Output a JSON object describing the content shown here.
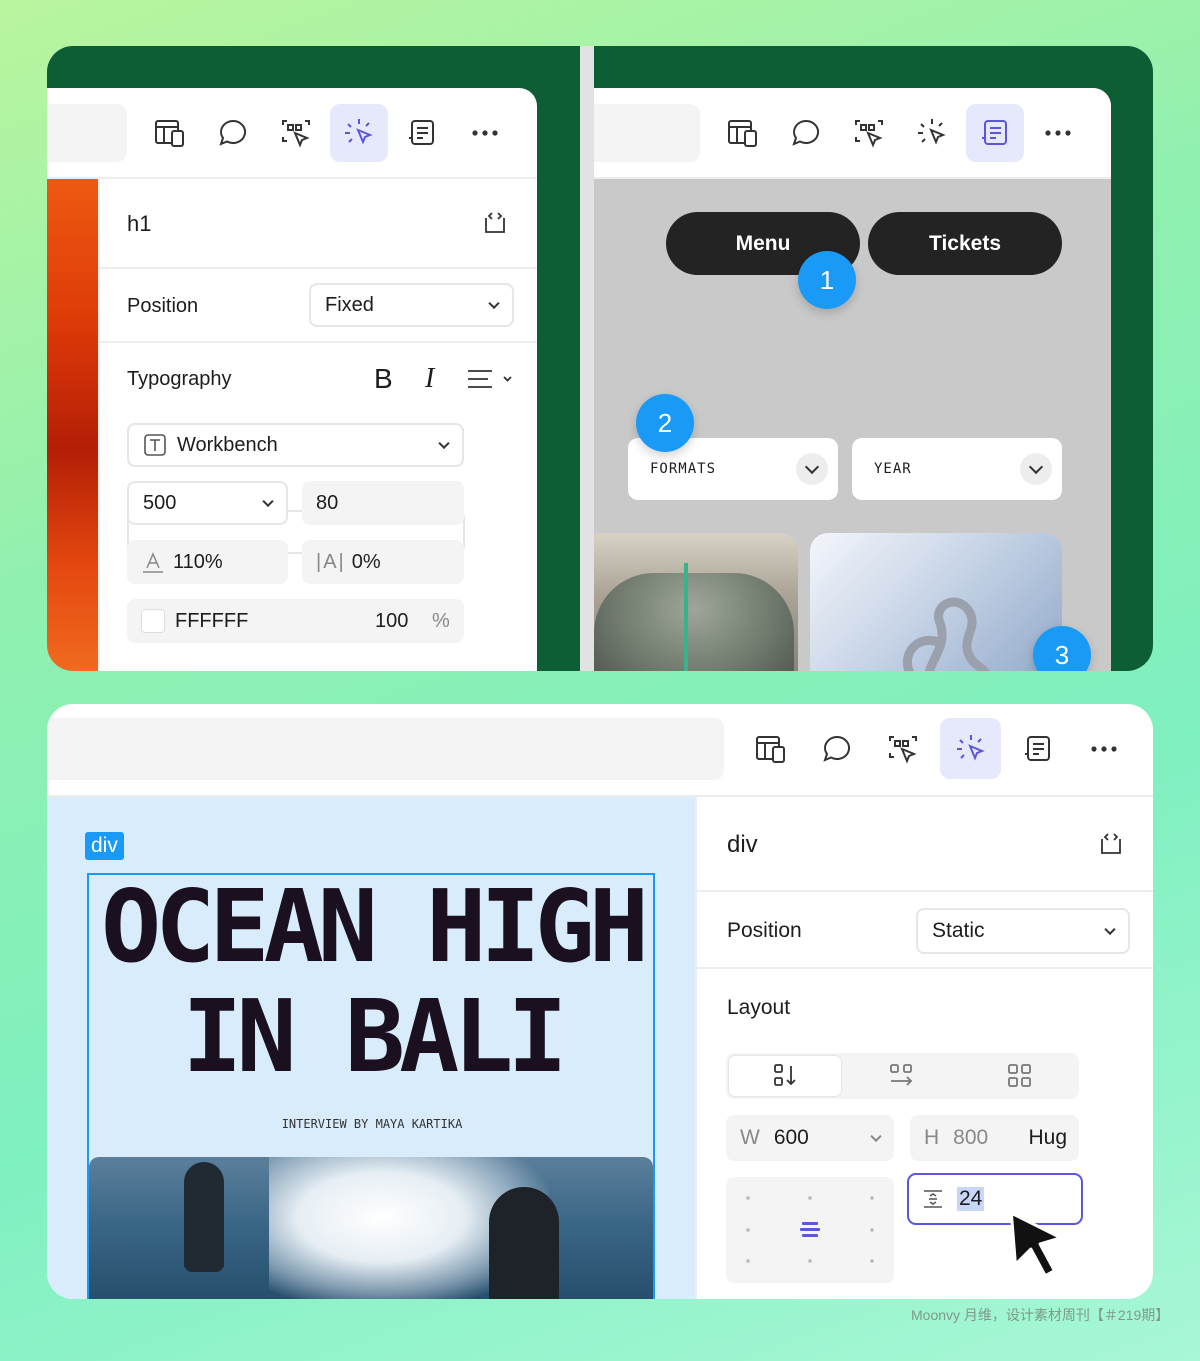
{
  "panel1": {
    "element_tag": "h1",
    "position_label": "Position",
    "position_value": "Fixed",
    "typography_label": "Typography",
    "bold_glyph": "B",
    "italic_glyph": "I",
    "font_family": "Workbench",
    "font_weight": "500",
    "font_size": "80",
    "line_height": "110%",
    "letter_spacing": "0%",
    "color_hex": "FFFFFF",
    "opacity": "100",
    "opacity_unit": "%"
  },
  "panel2": {
    "menu_label": "Menu",
    "tickets_label": "Tickets",
    "badge1": "1",
    "badge2": "2",
    "badge3": "3",
    "formats_label": "FORMATS",
    "year_label": "YEAR"
  },
  "panel3": {
    "div_tag": "div",
    "headline_line1": "OCEAN HIGH",
    "headline_line2": "IN BALI",
    "byline": "INTERVIEW BY MAYA KARTIKA",
    "element_tag": "div",
    "position_label": "Position",
    "position_value": "Static",
    "layout_label": "Layout",
    "width_label": "W",
    "width_value": "600",
    "height_label": "H",
    "height_value": "800",
    "height_mode": "Hug",
    "gap_value": "24"
  },
  "watermark": "Moonvy 月维，设计素材周刊【＃219期】",
  "colors": {
    "accent": "#5b55e0",
    "active_tab_bg": "#e6e8fb",
    "badge_blue": "#1a9af7",
    "dark_green": "#0d5e34",
    "canvas_light_blue": "#d9ecfc"
  }
}
